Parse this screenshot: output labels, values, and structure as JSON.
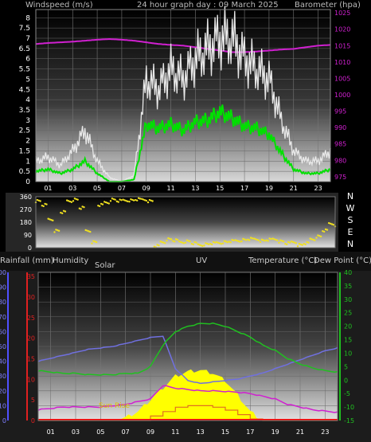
{
  "chart_data": [
    {
      "type": "line",
      "title": "24 hour graph day : 09 March 2025",
      "ylabel_left": "Windspeed (m/s)",
      "ylabel_right": "Barometer (hpa)",
      "xticks": [
        "01",
        "03",
        "05",
        "07",
        "09",
        "11",
        "13",
        "15",
        "17",
        "19",
        "21",
        "23"
      ],
      "yticks_left": [
        "0",
        "0.5",
        "1",
        "1.5",
        "2",
        "2.5",
        "3",
        "3.5",
        "4",
        "4.5",
        "5",
        "5.5",
        "6",
        "6.5",
        "7",
        "7.5",
        "8"
      ],
      "yticks_right": [
        "975",
        "980",
        "985",
        "990",
        "995",
        "1000",
        "1005",
        "1010",
        "1015",
        "1020",
        "1025"
      ],
      "ylim_left": [
        0,
        8.4
      ],
      "ylim_right": [
        973.5,
        1026
      ],
      "colors": {
        "gust": "#e8e8e8",
        "average": "#00e000",
        "barometer": "#d020d0",
        "left_axis": "#ffffff",
        "right_axis": "#d020d0"
      },
      "x_hours": [
        0,
        1,
        2,
        3,
        4,
        5,
        6,
        7,
        8,
        9,
        10,
        11,
        12,
        13,
        14,
        15,
        16,
        17,
        18,
        19,
        20,
        21,
        22,
        23,
        24
      ],
      "gust": [
        1.0,
        1.2,
        0.8,
        1.5,
        2.5,
        1.0,
        0.2,
        0.0,
        0.3,
        5.0,
        4.5,
        5.5,
        5.0,
        6.0,
        6.5,
        7.0,
        7.0,
        6.0,
        5.5,
        5.0,
        3.0,
        1.5,
        1.0,
        1.0,
        1.5
      ],
      "average": [
        0.5,
        0.6,
        0.4,
        0.6,
        1.0,
        0.4,
        0.0,
        0.0,
        0.1,
        2.8,
        2.6,
        2.8,
        2.5,
        2.9,
        3.0,
        3.4,
        3.1,
        2.7,
        2.6,
        2.3,
        1.4,
        0.6,
        0.4,
        0.4,
        0.6
      ],
      "barometer": [
        1015.5,
        1015.8,
        1016.0,
        1016.2,
        1016.5,
        1016.8,
        1017.0,
        1016.8,
        1016.5,
        1016.0,
        1015.5,
        1015.2,
        1015.0,
        1014.5,
        1014.0,
        1013.5,
        1013.0,
        1013.0,
        1013.2,
        1013.5,
        1013.8,
        1014.0,
        1014.5,
        1015.0,
        1015.2
      ]
    },
    {
      "type": "scatter",
      "ylabel_right": [
        "N",
        "W",
        "S",
        "E",
        "N"
      ],
      "yticks_left": [
        "360",
        "270",
        "180",
        "90",
        "0"
      ],
      "ylim": [
        0,
        360
      ],
      "color": "#f0e020",
      "x_hours": [
        0,
        0.5,
        1,
        1.5,
        2,
        2.5,
        3,
        3.5,
        4,
        4.5,
        5,
        5.5,
        6,
        6.5,
        7,
        7.5,
        8,
        8.5,
        9,
        9.5,
        10,
        10.5,
        11,
        11.5,
        12,
        12.5,
        13,
        13.5,
        14,
        14.5,
        15,
        15.5,
        16,
        16.5,
        17,
        17.5,
        18,
        18.5,
        19,
        19.5,
        20,
        20.5,
        21,
        21.5,
        22,
        22.5,
        23,
        23.5,
        24
      ],
      "direction": [
        330,
        300,
        200,
        120,
        250,
        330,
        340,
        280,
        120,
        40,
        300,
        320,
        340,
        330,
        335,
        335,
        340,
        340,
        330,
        10,
        40,
        60,
        50,
        40,
        45,
        30,
        20,
        25,
        30,
        35,
        40,
        45,
        50,
        55,
        60,
        60,
        50,
        55,
        60,
        45,
        30,
        40,
        20,
        30,
        60,
        80,
        120,
        170,
        160
      ]
    },
    {
      "type": "line",
      "labels": {
        "rain": "Rainfall (mm)",
        "humidity": "Humidity",
        "solar": "Solar",
        "uv": "UV",
        "temperature": "Temperature (°C)",
        "dewpoint": "Dew Point (°C)"
      },
      "annotation": "Sun Rise",
      "xticks": [
        "01",
        "03",
        "05",
        "07",
        "09",
        "11",
        "13",
        "15",
        "17",
        "19",
        "21",
        "23"
      ],
      "yticks_rain": [
        "0",
        "5",
        "10",
        "15",
        "20",
        "25",
        "30",
        "35"
      ],
      "yticks_humidity": [
        "0",
        "10",
        "20",
        "30",
        "40",
        "50",
        "60",
        "70",
        "80",
        "90",
        "100"
      ],
      "yticks_temp": [
        "-15",
        "-10",
        "-5",
        "0",
        "5",
        "10",
        "15",
        "20",
        "25",
        "30",
        "35",
        "40"
      ],
      "ylim_humidity": [
        0,
        100
      ],
      "ylim_temp": [
        -15,
        40
      ],
      "colors": {
        "rain_axis": "#e02020",
        "humidity_axis": "#6060e0",
        "humidity": "#7070e0",
        "temperature": "#20c020",
        "dewpoint": "#d020d0",
        "solar": "#ffff00",
        "uv_rain": "#e07020",
        "rain_line": "#ff0000",
        "temp_axis": "#20c020"
      },
      "x_hours": [
        0,
        1,
        2,
        3,
        4,
        5,
        6,
        7,
        8,
        9,
        10,
        11,
        12,
        13,
        14,
        15,
        16,
        17,
        18,
        19,
        20,
        21,
        22,
        23,
        24
      ],
      "humidity": [
        40,
        42,
        44,
        46,
        48,
        49,
        50,
        52,
        54,
        56,
        57,
        35,
        27,
        25,
        26,
        27,
        28,
        30,
        32,
        35,
        38,
        41,
        44,
        47,
        49
      ],
      "temperature": [
        3.5,
        3.0,
        2.5,
        2.5,
        2.0,
        2.0,
        2.0,
        2.5,
        2.5,
        5,
        13,
        18,
        20,
        21,
        21,
        20,
        18,
        16,
        13,
        11,
        8,
        6,
        4.5,
        3.5,
        3.0
      ],
      "dewpoint": [
        -11,
        -10.5,
        -10,
        -10,
        -10,
        -10,
        -9.5,
        -9,
        -8,
        -7,
        -2,
        -3,
        -3.5,
        -4,
        -4,
        -4.2,
        -4.5,
        -5,
        -6,
        -7,
        -9,
        -10,
        -11,
        -11.5,
        -12
      ],
      "solar": [
        0,
        0,
        0,
        0,
        0,
        0,
        0,
        2,
        6,
        14,
        22,
        30,
        33,
        34,
        32,
        27,
        17,
        6,
        0,
        0,
        0,
        0,
        0,
        0,
        0
      ],
      "uv": [
        0,
        0,
        0,
        0,
        0,
        0,
        0,
        0,
        0,
        3,
        6,
        9,
        10,
        10,
        9,
        7,
        4,
        1,
        0,
        0,
        0,
        0,
        0,
        0,
        0
      ],
      "rain": [
        0,
        0,
        0,
        0,
        0,
        0,
        0,
        0,
        0,
        0,
        0,
        0,
        0,
        0,
        0,
        0,
        0,
        0,
        0,
        0,
        0,
        0,
        0,
        0,
        0
      ]
    }
  ]
}
